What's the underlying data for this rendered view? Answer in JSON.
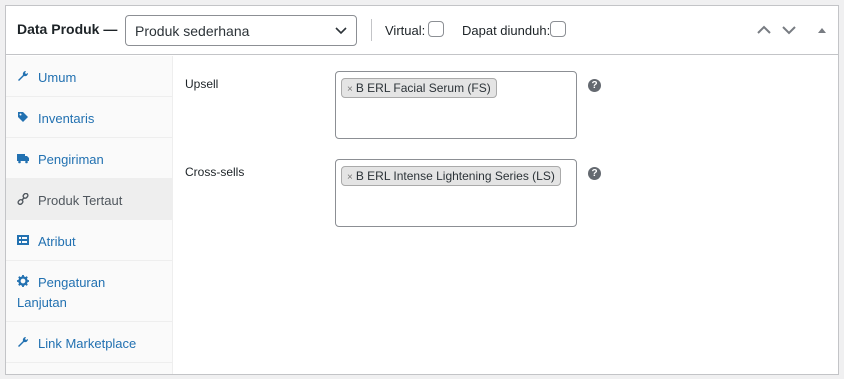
{
  "header": {
    "title": "Data Produk —",
    "product_type": "Produk sederhana",
    "virtual_label": "Virtual:",
    "downloadable_label": "Dapat diunduh:"
  },
  "sidebar": {
    "items": [
      {
        "label": "Umum",
        "icon": "wrench-icon"
      },
      {
        "label": "Inventaris",
        "icon": "tag-icon"
      },
      {
        "label": "Pengiriman",
        "icon": "truck-icon"
      },
      {
        "label": "Produk Tertaut",
        "icon": "link-icon"
      },
      {
        "label": "Atribut",
        "icon": "list-icon"
      },
      {
        "label_line1": "Pengaturan",
        "label_line2": "Lanjutan",
        "icon": "gear-icon"
      },
      {
        "label": "Link Marketplace",
        "icon": "wrench-icon"
      }
    ]
  },
  "fields": {
    "upsell": {
      "label": "Upsell",
      "chip": "B ERL Facial Serum (FS)",
      "help": "?"
    },
    "crosssell": {
      "label": "Cross-sells",
      "chip": "B ERL Intense Lightening Series (LS)",
      "help": "?"
    }
  },
  "chip_remove": "×",
  "colors": {
    "link": "#2271b1",
    "border": "#c3c4c7",
    "active_tab_bg": "#eeeeee"
  }
}
